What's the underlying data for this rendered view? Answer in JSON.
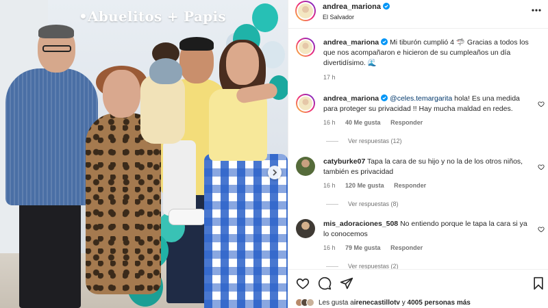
{
  "photo": {
    "caption": "•Abuelitos + Papis"
  },
  "post": {
    "author": "andrea_mariona",
    "location": "El Salvador"
  },
  "caption": {
    "username": "andrea_mariona",
    "text": "Mi tiburón cumplió 4 🦈 Gracias a todos los que nos acompañaron e hicieron de su cumpleaños un día divertidísimo. 🌊",
    "time": "17 h"
  },
  "comments": [
    {
      "username": "andrea_mariona",
      "mention": "@celes.temargarita",
      "text": " hola! Es una medida para proteger su privacidad !! Hay mucha maldad en redes.",
      "time": "16 h",
      "likes": "40 Me gusta",
      "reply_label": "Responder",
      "view_replies": "Ver respuestas (12)"
    },
    {
      "username": "catyburke07",
      "mention": "",
      "text": " Tapa la cara de su hijo y no la de los otros niños, también es privacidad",
      "time": "16 h",
      "likes": "120 Me gusta",
      "reply_label": "Responder",
      "view_replies": "Ver respuestas (8)"
    },
    {
      "username": "mis_adoraciones_508",
      "mention": "",
      "text": " No entiendo porque le tapa la cara si ya lo conocemos",
      "time": "16 h",
      "likes": "79 Me gusta",
      "reply_label": "Responder",
      "view_replies": "Ver respuestas (2)"
    }
  ],
  "likes_bar": {
    "prefix": "Les gusta a ",
    "user": "irenecastillotv",
    "middle": " y ",
    "count": "4005 personas más"
  },
  "icons": [
    "verified-icon",
    "more-options-icon",
    "heart-icon",
    "comment-icon",
    "share-icon",
    "bookmark-icon",
    "chevron-right-icon"
  ],
  "colors": {
    "verified": "#0095f6",
    "mention": "#00376b",
    "muted": "#737373",
    "text": "#262626"
  }
}
